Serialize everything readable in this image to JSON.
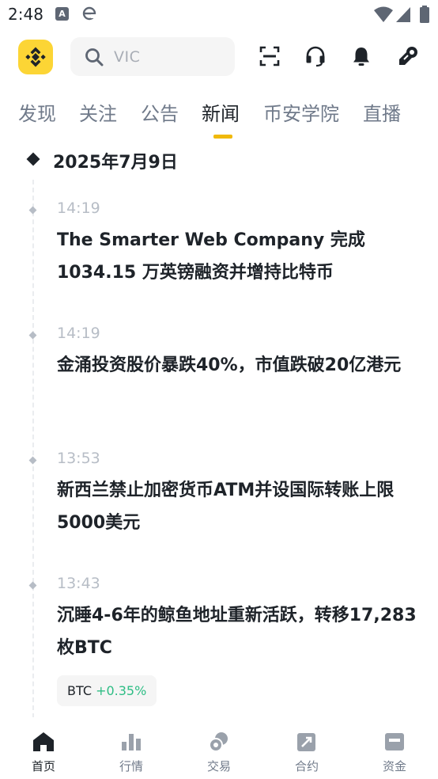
{
  "status_bar": {
    "time": "2:48",
    "icons": [
      "a-icon",
      "browser-e-icon",
      "wifi-icon",
      "cell-signal-icon",
      "battery-icon"
    ],
    "a_glyph": "A"
  },
  "header": {
    "logo": "binance-logo-icon",
    "search": {
      "value": "VIC"
    },
    "icons": [
      "scan-icon",
      "support-headset-icon",
      "notification-bell-icon",
      "referral-icon"
    ]
  },
  "tabs": [
    {
      "label": "发现",
      "active": false
    },
    {
      "label": "关注",
      "active": false
    },
    {
      "label": "公告",
      "active": false
    },
    {
      "label": "新闻",
      "active": true
    },
    {
      "label": "币安学院",
      "active": false
    },
    {
      "label": "直播",
      "active": false
    }
  ],
  "news": {
    "date": "2025年7月9日",
    "items": [
      {
        "time": "14:19",
        "title": "The Smarter Web Company 完成 1034.15 万英镑融资并增持比特币"
      },
      {
        "time": "14:19",
        "title": "金涌投资股价暴跌40%，市值跌破20亿港元"
      },
      {
        "time": "13:53",
        "title": "新西兰禁止加密货币ATM并设国际转账上限5000美元"
      },
      {
        "time": "13:43",
        "title": "沉睡4-6年的鲸鱼地址重新活跃，转移17,283枚BTC",
        "coin": {
          "symbol": "BTC",
          "change": "+0.35%"
        }
      }
    ]
  },
  "bottom_nav": [
    {
      "label": "首页",
      "icon": "home-icon",
      "active": true
    },
    {
      "label": "行情",
      "icon": "markets-icon",
      "active": false
    },
    {
      "label": "交易",
      "icon": "trade-icon",
      "active": false
    },
    {
      "label": "合约",
      "icon": "futures-icon",
      "active": false
    },
    {
      "label": "资金",
      "icon": "wallet-icon",
      "active": false
    }
  ],
  "colors": {
    "brand_yellow": "#FCD535",
    "accent": "#F0B90B",
    "text_primary": "#1E2329",
    "text_secondary": "#707A8A",
    "positive": "#2EBD85"
  }
}
